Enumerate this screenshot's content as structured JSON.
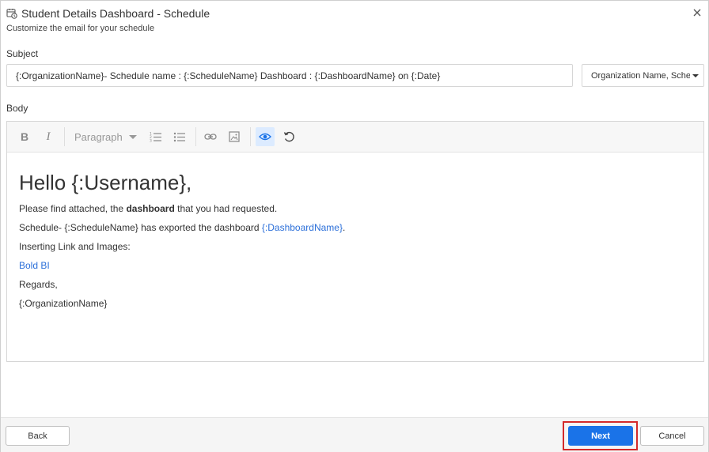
{
  "dialog": {
    "title": "Student Details Dashboard - Schedule",
    "subtitle": "Customize the email for your schedule"
  },
  "subject": {
    "label": "Subject",
    "value": "{:OrganizationName}- Schedule name : {:ScheduleName} Dashboard : {:DashboardName} on {:Date}",
    "dropdown_value": "Organization Name, Sche"
  },
  "body": {
    "label": "Body",
    "toolbar": {
      "paragraph_label": "Paragraph"
    },
    "content": {
      "greeting": "Hello {:Username},",
      "line1_prefix": "Please find attached, the ",
      "line1_bold": "dashboard",
      "line1_suffix": " that you had requested.",
      "line2_prefix": "Schedule- {:ScheduleName} has exported the dashboard ",
      "line2_link": "{:DashboardName}",
      "line2_suffix": ".",
      "line3": "Inserting Link and Images:",
      "link_text": "Bold BI",
      "regards": "Regards,",
      "signature": "{:OrganizationName}"
    }
  },
  "footer": {
    "back_label": "Back",
    "next_label": "Next",
    "cancel_label": "Cancel"
  },
  "colors": {
    "primary": "#1a73e8",
    "link": "#2b6fd9",
    "highlight_border": "#d42a2a"
  }
}
